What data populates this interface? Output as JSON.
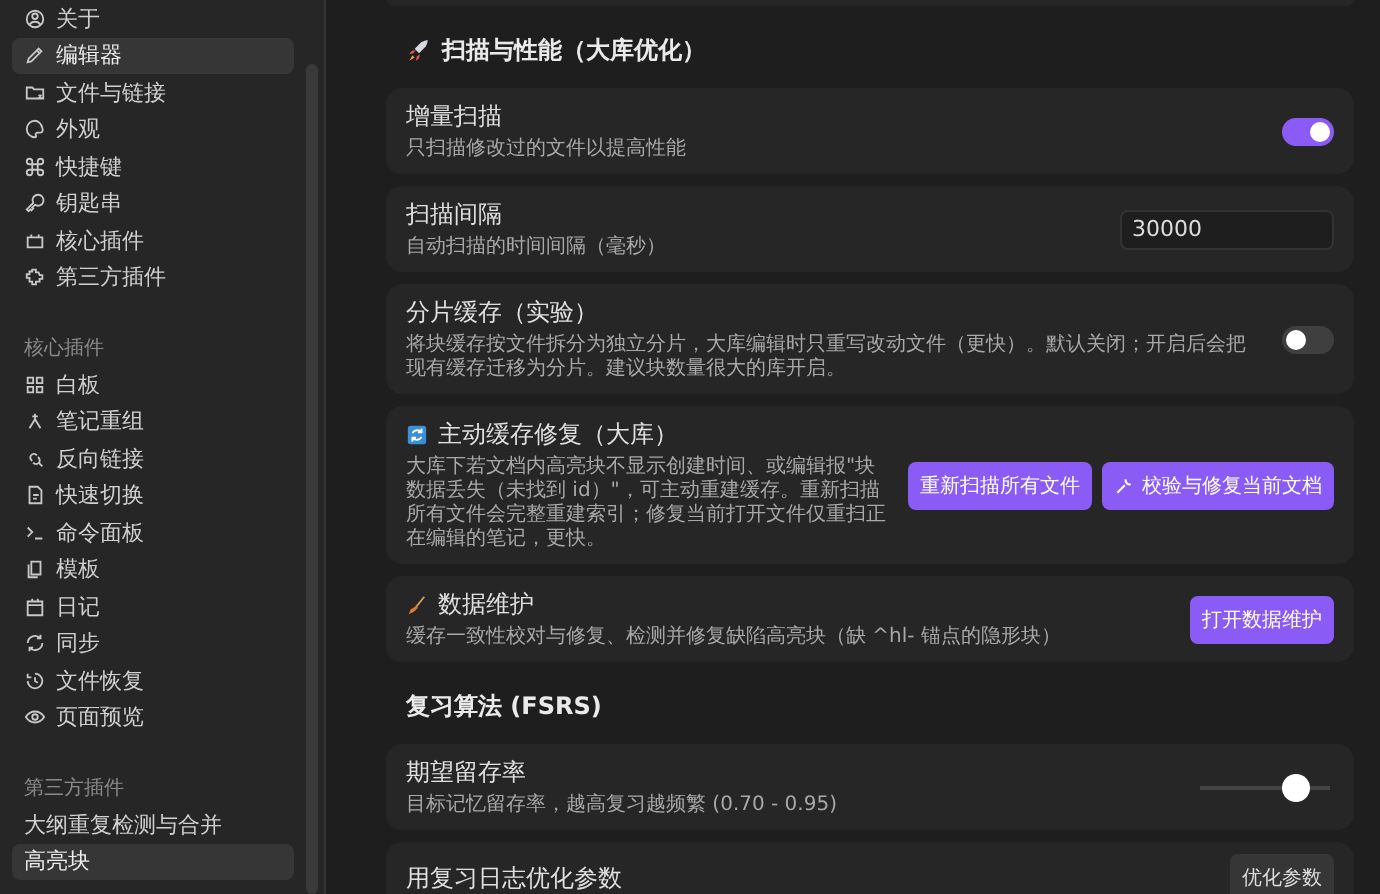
{
  "sidebar": {
    "items": [
      {
        "label": "关于",
        "selected": false
      },
      {
        "label": "编辑器",
        "selected": true
      },
      {
        "label": "文件与链接",
        "selected": false
      },
      {
        "label": "外观",
        "selected": false
      },
      {
        "label": "快捷键",
        "selected": false
      },
      {
        "label": "钥匙串",
        "selected": false
      },
      {
        "label": "核心插件",
        "selected": false
      },
      {
        "label": "第三方插件",
        "selected": false
      }
    ],
    "groups": [
      {
        "title": "核心插件",
        "items": [
          {
            "label": "白板",
            "selected": false
          },
          {
            "label": "笔记重组",
            "selected": false
          },
          {
            "label": "反向链接",
            "selected": false
          },
          {
            "label": "快速切换",
            "selected": false
          },
          {
            "label": "命令面板",
            "selected": false
          },
          {
            "label": "模板",
            "selected": false
          },
          {
            "label": "日记",
            "selected": false
          },
          {
            "label": "同步",
            "selected": false
          },
          {
            "label": "文件恢复",
            "selected": false
          },
          {
            "label": "页面预览",
            "selected": false
          }
        ]
      },
      {
        "title": "第三方插件",
        "items": [
          {
            "label": "大纲重复检测与合并",
            "selected": false
          },
          {
            "label": "高亮块",
            "selected": true
          }
        ]
      }
    ]
  },
  "sections": [
    {
      "title": "扫描与性能（大库优化）",
      "settings": [
        {
          "kind": "toggle",
          "name": "增量扫描",
          "description": "只扫描修改过的文件以提高性能",
          "on": true
        },
        {
          "kind": "input",
          "name": "扫描间隔",
          "description": "自动扫描的时间间隔（毫秒）",
          "value": "30000"
        },
        {
          "kind": "toggle",
          "name": "分片缓存（实验）",
          "description": "将块缓存按文件拆分为独立分片，大库编辑时只重写改动文件（更快）。默认关闭；开启后会把现有缓存迁移为分片。建议块数量很大的库开启。",
          "on": false
        },
        {
          "kind": "buttons",
          "name": "主动缓存修复（大库）",
          "description": "大库下若文档内高亮块不显示创建时间、或编辑报\"块数据丢失（未找到 id）\"，可主动重建缓存。重新扫描所有文件会完整重建索引；修复当前打开文件仅重扫正在编辑的笔记，更快。",
          "buttons": [
            "重新扫描所有文件",
            "校验与修复当前文档"
          ]
        },
        {
          "kind": "buttons",
          "name": "数据维护",
          "description": "缓存一致性校对与修复、检测并修复缺陷高亮块（缺 ^hl- 锚点的隐形块）",
          "buttons": [
            "打开数据维护"
          ]
        }
      ]
    },
    {
      "title": "复习算法 (FSRS)",
      "settings": [
        {
          "kind": "slider",
          "name": "期望留存率",
          "description": "目标记忆留存率，越高复习越频繁 (0.70 - 0.95)",
          "level": 0.75
        },
        {
          "kind": "plainbutton",
          "name": "用复习日志优化参数",
          "buttons": [
            "优化参数"
          ]
        }
      ]
    }
  ]
}
